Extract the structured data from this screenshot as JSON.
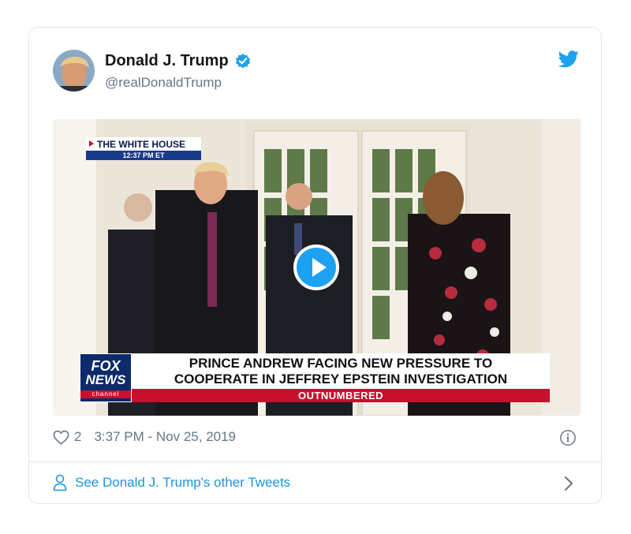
{
  "tweet": {
    "author_name": "Donald J. Trump",
    "handle": "@realDonaldTrump",
    "likes": "2",
    "timestamp": "3:37 PM - Nov 25, 2019",
    "footer_link": "See Donald J. Trump's other Tweets"
  },
  "video": {
    "location_tag": "THE WHITE HOUSE",
    "time_tag": "12:37 PM ET",
    "network_line1": "FOX",
    "network_line2": "NEWS",
    "network_line3": "channel",
    "headline_line1": "PRINCE ANDREW FACING NEW PRESSURE TO",
    "headline_line2": "COOPERATE IN JEFFREY EPSTEIN INVESTIGATION",
    "show_name": "OUTNUMBERED"
  },
  "icons": {
    "verified": "verified-badge-icon",
    "brand": "twitter-bird-icon",
    "like": "heart-icon",
    "info": "info-icon",
    "profile": "person-icon",
    "chevron": "chevron-right-icon"
  },
  "colors": {
    "brand_blue": "#1da1f2",
    "link_blue": "#1b95e0",
    "text_primary": "#14171a",
    "text_secondary": "#657786",
    "fox_red": "#c8102e",
    "fox_navy": "#0d2a6b"
  }
}
